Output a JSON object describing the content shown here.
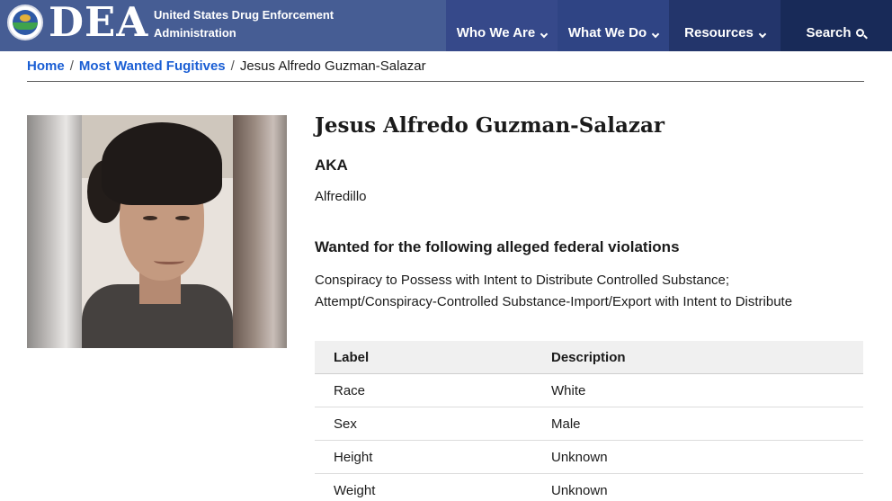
{
  "header": {
    "logo_text": "DEA",
    "agency_line1": "United States Drug Enforcement",
    "agency_line2": "Administration",
    "nav": [
      {
        "label": "Who We Are"
      },
      {
        "label": "What We Do"
      },
      {
        "label": "Resources"
      },
      {
        "label": "Search"
      }
    ],
    "colors": {
      "bar": "#465d94",
      "nav_dark": "#182a58"
    }
  },
  "breadcrumb": {
    "home": "Home",
    "section": "Most Wanted Fugitives",
    "current": "Jesus Alfredo Guzman-Salazar",
    "separator": "/"
  },
  "profile": {
    "name": "Jesus Alfredo Guzman-Salazar",
    "aka_label": "AKA",
    "aka_value": "Alfredillo",
    "violations_title": "Wanted for the following alleged federal violations",
    "violations_line1": "Conspiracy to Possess with Intent to Distribute Controlled Substance;",
    "violations_line2": "Attempt/Conspiracy-Controlled Substance-Import/Export with Intent to Distribute"
  },
  "table": {
    "headers": {
      "label": "Label",
      "description": "Description"
    },
    "rows": [
      {
        "label": "Race",
        "description": "White"
      },
      {
        "label": "Sex",
        "description": "Male"
      },
      {
        "label": "Height",
        "description": "Unknown"
      },
      {
        "label": "Weight",
        "description": "Unknown"
      }
    ]
  },
  "link_color": "#1a5ed4"
}
